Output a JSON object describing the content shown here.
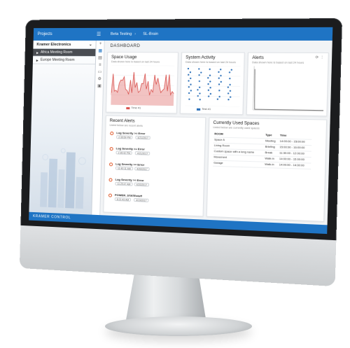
{
  "topbar": {
    "projects_label": "Projects",
    "breadcrumb": [
      "Beta Testing",
      "SL-Brain"
    ]
  },
  "sidebar": {
    "org_name": "Kramer Electronics",
    "rooms": [
      {
        "label": "Africa Meeting Room",
        "active": true
      },
      {
        "label": "Europe Meeting Room",
        "active": false
      }
    ]
  },
  "footer": {
    "brand": "KRAMER CONTROL"
  },
  "page": {
    "title": "DASHBOARD"
  },
  "space_usage": {
    "title": "Space Usage",
    "subtitle": "Data shown here is based on last 24 hours",
    "legend": "Time #1"
  },
  "system_activity": {
    "title": "System Activity",
    "subtitle": "Data shown here is based on last 24 hours",
    "legend": "Test #1"
  },
  "alerts_card": {
    "title": "Alerts",
    "subtitle": "Data shown here is based on last 24 hours"
  },
  "recent_alerts": {
    "title": "Recent Alerts",
    "subtitle": "Listed below are recent alerts",
    "items": [
      {
        "title": "Log Severity >= Error",
        "time": "2:35:59 PM",
        "date": "4/21/2017"
      },
      {
        "title": "Log Severity >= Error",
        "time": "2:35:42 PM",
        "date": "4/21/2017"
      },
      {
        "title": "Log Severity >= Error",
        "time": "11:40:11 AM",
        "date": "4/20/2017"
      },
      {
        "title": "Log Severity >= Error",
        "time": "11:29:47 AM",
        "date": "4/20/2017"
      },
      {
        "title": "POWER_STATEstuff",
        "time": "8:21:43 AM",
        "date": "4/19/2017"
      }
    ]
  },
  "used_spaces": {
    "title": "Currently Used Spaces",
    "subtitle": "Listed below are currently used spaces",
    "headers": [
      "ROOM",
      "Type",
      "Time"
    ],
    "rows": [
      [
        "Space A",
        "Meeting",
        "14:00:00 - 15:00:00"
      ],
      [
        "Living Room",
        "Briefing",
        "15:00:00 - 16:00:00"
      ],
      [
        "Custom space with a long name",
        "Break",
        "11:30:00 - 12:00:00"
      ],
      [
        "Movement",
        "Walk-in",
        "14:00:00 - 15:00:00"
      ],
      [
        "Garage",
        "Walk-in",
        "14:00:00 - 14:30:00"
      ]
    ]
  },
  "colors": {
    "brand_blue": "#1f74c4",
    "usage_red": "#d9534f",
    "activity_blue": "#2a6fb8",
    "alert_orange": "#e05a2b"
  }
}
